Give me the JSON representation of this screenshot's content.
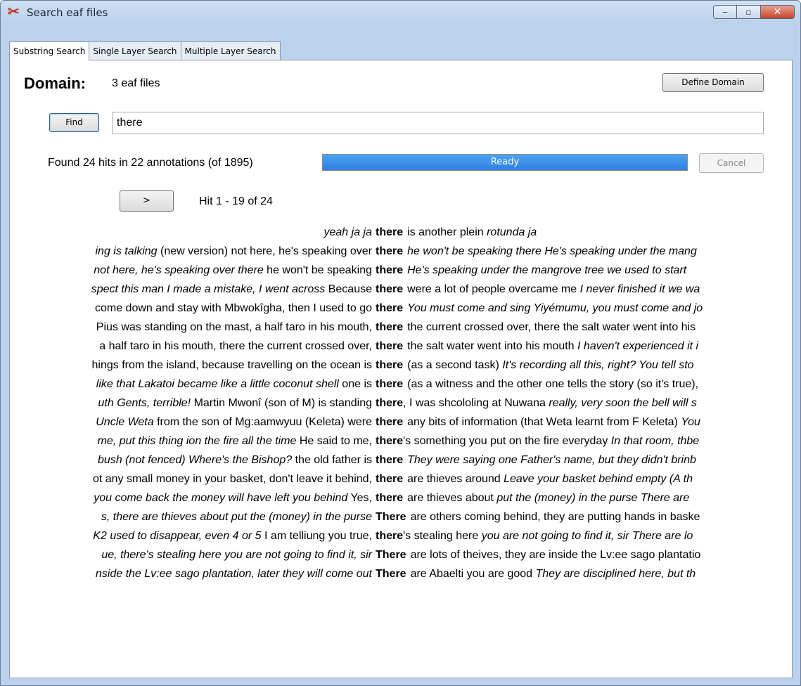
{
  "window": {
    "title": "Search eaf files",
    "minimize": "‒",
    "maximize": "▫",
    "close": "✕"
  },
  "tabs": [
    "Substring Search",
    "Single Layer Search",
    "Multiple Layer Search"
  ],
  "domain": {
    "label": "Domain:",
    "value": "3 eaf files",
    "define_button": "Define Domain"
  },
  "search": {
    "find_button": "Find",
    "query": "there"
  },
  "status": {
    "text": "Found 24 hits in 22 annotations (of 1895)",
    "progress_label": "Ready",
    "progress_fraction": 1.0,
    "cancel_button": "Cancel"
  },
  "navigation": {
    "next_button": ">",
    "hit_range": "Hit 1 - 19 of 24"
  },
  "results": [
    {
      "left": [
        {
          "t": "yeah  ja  ja",
          "i": true
        }
      ],
      "match": "there",
      "right": [
        {
          "t": "is another plein",
          "i": false
        },
        {
          "t": "rotunda  ja",
          "i": true
        }
      ]
    },
    {
      "left": [
        {
          "t": "ing is talking",
          "i": true
        },
        {
          "t": "(new version) not here, he's speaking over",
          "i": false
        }
      ],
      "match": "there",
      "right": [
        {
          "t": "he won't be speaking there  He's speaking under the mang",
          "i": true
        }
      ]
    },
    {
      "left": [
        {
          "t": "not here, he's speaking over there",
          "i": true
        },
        {
          "t": "he won't be speaking",
          "i": false
        }
      ],
      "match": "there",
      "right": [
        {
          "t": "He's speaking under the mangrove tree    we used to start",
          "i": true
        }
      ]
    },
    {
      "left": [
        {
          "t": "spect this man  I made a mistake, I went across",
          "i": true
        },
        {
          "t": "Because",
          "i": false
        }
      ],
      "match": "there",
      "right": [
        {
          "t": "were a lot of people overcame me",
          "i": false
        },
        {
          "t": "I never finished it  we wa",
          "i": true
        }
      ]
    },
    {
      "left": [
        {
          "t": "come down and stay with Mbwokîgha, then I used to go",
          "i": false
        }
      ],
      "match": "there",
      "right": [
        {
          "t": "You must come and sing Yiyémumu, you must come and jo",
          "i": true
        }
      ]
    },
    {
      "left": [
        {
          "t": "Pius was standing on the mast, a half taro in his mouth,",
          "i": false
        }
      ],
      "match": "there",
      "right": [
        {
          "t": "the current crossed over, there the salt water went into his",
          "i": false
        }
      ]
    },
    {
      "left": [
        {
          "t": "a half taro in his mouth, there the current crossed over,",
          "i": false
        }
      ],
      "match": "there",
      "right": [
        {
          "t": "the salt water went into his mouth",
          "i": false
        },
        {
          "t": "I haven't experienced it i",
          "i": true
        }
      ]
    },
    {
      "left": [
        {
          "t": "hings from the island, because travelling on the ocean is",
          "i": false
        }
      ],
      "match": "there",
      "right": [
        {
          "t": "(as a second task)",
          "i": false
        },
        {
          "t": "It's recording all this, right?  You tell sto",
          "i": true
        }
      ]
    },
    {
      "left": [
        {
          "t": "like that  Lakatoi became like a little coconut shell",
          "i": true
        },
        {
          "t": "one is",
          "i": false
        }
      ],
      "match": "there",
      "right": [
        {
          "t": "(as a witness and the other one tells the story (so it's true),",
          "i": false
        }
      ]
    },
    {
      "left": [
        {
          "t": "uth  Gents, terrible!",
          "i": true
        },
        {
          "t": "Martin Mwonî (son of M) is standing",
          "i": false
        }
      ],
      "match": "there",
      "right": [
        {
          "t": ", I was shcololing at Nuwana",
          "i": false
        },
        {
          "t": "really, very soon the bell will s",
          "i": true
        }
      ]
    },
    {
      "left": [
        {
          "t": "Uncle Weta",
          "i": true
        },
        {
          "t": "from the son of Mg:aamwyuu (Keleta) were",
          "i": false
        }
      ],
      "match": "there",
      "right": [
        {
          "t": "any bits of information (that Weta learnt from F Keleta)",
          "i": false
        },
        {
          "t": "You",
          "i": true
        }
      ]
    },
    {
      "left": [
        {
          "t": "me, put this thing ion the fire all the time",
          "i": true
        },
        {
          "t": "He said to me,",
          "i": false
        }
      ],
      "match": "there",
      "right": [
        {
          "t": "'s something you put on the fire everyday",
          "i": false
        },
        {
          "t": "In that room, thbe",
          "i": true
        }
      ]
    },
    {
      "left": [
        {
          "t": "bush (not fenced)  Where's the Bishop?",
          "i": true
        },
        {
          "t": "the old father is",
          "i": false
        }
      ],
      "match": "there",
      "right": [
        {
          "t": "They were saying one Father's name, but they didn't brinb",
          "i": true
        }
      ]
    },
    {
      "left": [
        {
          "t": "ot any small money in your basket, don't leave it behind,",
          "i": false
        }
      ],
      "match": "there",
      "right": [
        {
          "t": "are thieves around",
          "i": false
        },
        {
          "t": "Leave your basket behind empty  (A th",
          "i": true
        }
      ]
    },
    {
      "left": [
        {
          "t": "you come back the money will have left you behind",
          "i": true
        },
        {
          "t": "Yes,",
          "i": false
        }
      ],
      "match": "there",
      "right": [
        {
          "t": "are thieves about",
          "i": false
        },
        {
          "t": "put the (money) in the purse  There are",
          "i": true
        }
      ]
    },
    {
      "left": [
        {
          "t": "s, there are thieves about  put the (money) in the purse",
          "i": true
        }
      ],
      "match": "There",
      "right": [
        {
          "t": "are others coming behind, they are putting hands in baske",
          "i": false
        }
      ]
    },
    {
      "left": [
        {
          "t": "K2 used to disappear, even 4 or 5",
          "i": true
        },
        {
          "t": "I am telliung you true,",
          "i": false
        }
      ],
      "match": "there",
      "right": [
        {
          "t": "'s stealing here",
          "i": false
        },
        {
          "t": "you are not going to find it, sir  There are lo",
          "i": true
        }
      ]
    },
    {
      "left": [
        {
          "t": "ue, there's stealing here  you are not going to find it, sir",
          "i": true
        }
      ],
      "match": "There",
      "right": [
        {
          "t": "are lots of theives, they are inside the Lv:ee sago plantatio",
          "i": false
        }
      ]
    },
    {
      "left": [
        {
          "t": "nside the Lv:ee sago plantation, later they will come out",
          "i": true
        }
      ],
      "match": "There",
      "right": [
        {
          "t": "are Abaelti you are good",
          "i": false
        },
        {
          "t": "They are disciplined here, but th",
          "i": true
        }
      ]
    }
  ]
}
